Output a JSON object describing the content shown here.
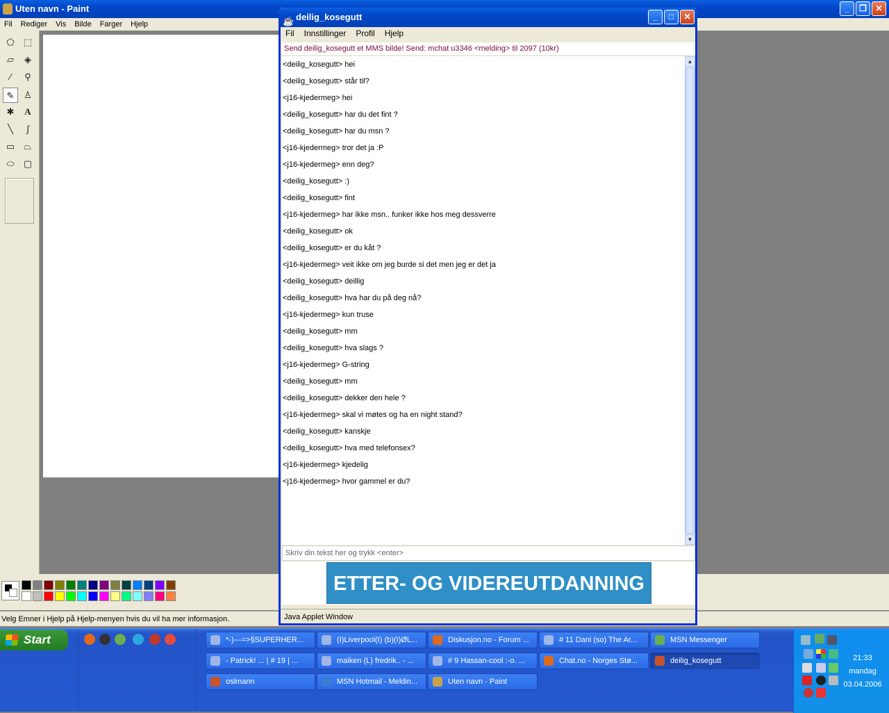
{
  "paint": {
    "title": "Uten navn - Paint",
    "menu": [
      "Fil",
      "Rediger",
      "Vis",
      "Bilde",
      "Farger",
      "Hjelp"
    ],
    "status": "Velg Emner i Hjelp på Hjelp-menyen hvis du vil ha mer informasjon.",
    "tools": [
      "free-select-icon",
      "rect-select-icon",
      "eraser-icon",
      "fill-icon",
      "color-picker-icon",
      "magnifier-icon",
      "pencil-icon",
      "brush-icon",
      "airbrush-icon",
      "text-icon",
      "line-icon",
      "curve-icon",
      "rectangle-icon",
      "polygon-icon",
      "ellipse-icon",
      "rounded-rect-icon"
    ],
    "palette_top": [
      "#000000",
      "#808080",
      "#800000",
      "#808000",
      "#008000",
      "#008080",
      "#000080",
      "#800080",
      "#808040",
      "#004040",
      "#0080ff",
      "#004080",
      "#8000ff",
      "#804000"
    ],
    "palette_bottom": [
      "#ffffff",
      "#c0c0c0",
      "#ff0000",
      "#ffff00",
      "#00ff00",
      "#00ffff",
      "#0000ff",
      "#ff00ff",
      "#ffff80",
      "#00ff80",
      "#80ffff",
      "#8080ff",
      "#ff0080",
      "#ff8040"
    ]
  },
  "chat": {
    "title": "deilig_kosegutt",
    "menu": [
      "Fil",
      "Innstillinger",
      "Profil",
      "Hjelp"
    ],
    "promo": "Send deilig_kosegutt et MMS bilde! Send: mchat u3346 <melding> til 2097 (10kr)",
    "messages": [
      "<deilig_kosegutt> hei",
      "<deilig_kosegutt> står til?",
      "<j16-kjedermeg> hei",
      "<deilig_kosegutt> har du det fint ?",
      "<deilig_kosegutt> har du msn ?",
      "<j16-kjedermeg> tror det ja :P",
      "<j16-kjedermeg> enn deg?",
      "<deilig_kosegutt> :)",
      "<deilig_kosegutt> fint",
      "<j16-kjedermeg> har ikke msn.. funker ikke hos meg dessverre",
      "<deilig_kosegutt> ok",
      "<deilig_kosegutt> er du kåt ?",
      "<j16-kjedermeg> veit ikke om jeg burde si det men jeg er det ja",
      "<deilig_kosegutt> deillig",
      "<deilig_kosegutt> hva har du på deg nå?",
      "<j16-kjedermeg> kun truse",
      "<deilig_kosegutt> mm",
      "<deilig_kosegutt> hva slags ?",
      "<j16-kjedermeg> G-string",
      "<deilig_kosegutt> mm",
      "<deilig_kosegutt> dekker den hele ?",
      "<j16-kjedermeg> skal vi møtes og ha en night stand?",
      "<deilig_kosegutt> kanskje",
      "<deilig_kosegutt> hva med telefonsex?",
      "<j16-kjedermeg> kjedelig",
      "<j16-kjedermeg> hvor gammel er du?"
    ],
    "input_placeholder": "Skriv din tekst her og trykk <enter>",
    "ad_text": "ETTER- OG VIDEREUTDANNING",
    "applet_label": "Java Applet Window"
  },
  "taskbar": {
    "start": "Start",
    "buttons": [
      {
        "label": "*-)---=>§SUPERHER...",
        "icon": "chat-icon",
        "active": false
      },
      {
        "label": "(I)Liverpool(I) (b)(I)ØL...",
        "icon": "chat-icon",
        "active": false
      },
      {
        "label": "Diskusjon.no - Forum ...",
        "icon": "firefox-icon",
        "active": false
      },
      {
        "label": "# 11 Dani (so) The Ar...",
        "icon": "chat-icon",
        "active": false
      },
      {
        "label": "MSN Messenger",
        "icon": "msn-icon",
        "active": false
      },
      {
        "label": "- Patrick! ... | # 19 | ...",
        "icon": "chat-icon",
        "active": false
      },
      {
        "label": "maiken (L) fredrik.. - ...",
        "icon": "chat-icon",
        "active": false
      },
      {
        "label": "# 9 Hassan-cool :-o. ...",
        "icon": "chat-icon",
        "active": false
      },
      {
        "label": "Chat.no - Norges Stø...",
        "icon": "firefox-icon",
        "active": false
      },
      {
        "label": "deilig_kosegutt",
        "icon": "java-icon",
        "active": true
      },
      {
        "label": "oslmann",
        "icon": "java-icon",
        "active": false
      },
      {
        "label": "MSN Hotmail - Meldin...",
        "icon": "hotmail-icon",
        "active": false
      },
      {
        "label": "Uten navn - Paint",
        "icon": "paint-icon",
        "active": false
      }
    ],
    "clock": {
      "time": "21:33",
      "day": "mandag",
      "date": "03.04.2006"
    }
  }
}
